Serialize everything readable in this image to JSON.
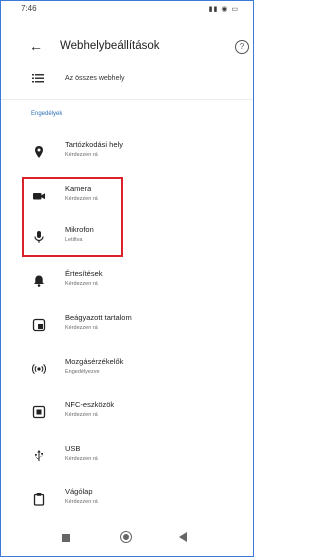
{
  "status_bar": {
    "time": "7:46",
    "indicators": "▮▮ ◉ ▭"
  },
  "appbar": {
    "title": "Webhelybeállítások",
    "back_icon": "←",
    "help_icon": "?"
  },
  "all_sites": {
    "label": "Az összes webhely"
  },
  "section": {
    "title": "Engedélyek"
  },
  "permissions": [
    {
      "name": "location",
      "title": "Tartózkodási hely",
      "subtitle": "Kérdezzen rá",
      "icon": "location-pin-icon"
    },
    {
      "name": "camera",
      "title": "Kamera",
      "subtitle": "Kérdezzen rá",
      "icon": "camera-icon"
    },
    {
      "name": "microphone",
      "title": "Mikrofon",
      "subtitle": "Letiltva",
      "icon": "microphone-icon"
    },
    {
      "name": "notifications",
      "title": "Értesítések",
      "subtitle": "Kérdezzen rá",
      "icon": "bell-icon"
    },
    {
      "name": "embedded-content",
      "title": "Beágyazott tartalom",
      "subtitle": "Kérdezzen rá",
      "icon": "embedded-content-icon"
    },
    {
      "name": "motion-sensors",
      "title": "Mozgásérzékelők",
      "subtitle": "Engedélyezve",
      "icon": "motion-sensor-icon"
    },
    {
      "name": "nfc-devices",
      "title": "NFC-eszközök",
      "subtitle": "Kérdezzen rá",
      "icon": "nfc-icon"
    },
    {
      "name": "usb",
      "title": "USB",
      "subtitle": "Kérdezzen rá",
      "icon": "usb-icon"
    },
    {
      "name": "clipboard",
      "title": "Vágólap",
      "subtitle": "Kérdezzen rá",
      "icon": "clipboard-icon"
    }
  ],
  "colors": {
    "section_accent": "#2f6fb8",
    "highlight_box": "#d9232a",
    "frame_border": "#3c7ad8"
  }
}
